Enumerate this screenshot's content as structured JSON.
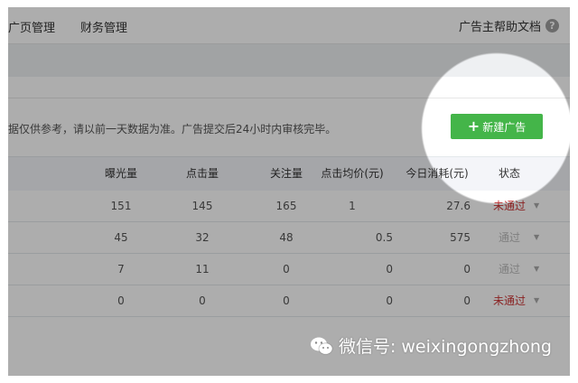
{
  "nav": {
    "items": [
      "广页管理",
      "财务管理"
    ],
    "help_label": "广告主帮助文档",
    "help_icon": "question-circle-icon"
  },
  "notice": "据仅供参考，请以前一天数据为准。广告提交后24小时内审核完毕。",
  "new_ad_button": {
    "label": "新建广告",
    "icon": "plus-icon"
  },
  "table": {
    "headers": [
      "曝光量",
      "点击量",
      "关注量",
      "点击均价(元)",
      "今日消耗(元)",
      "状态"
    ],
    "rows": [
      {
        "impressions": "151",
        "clicks": "145",
        "follows": "165",
        "avg_cpc": "1",
        "spend": "27.6",
        "status": "未通过",
        "status_kind": "fail"
      },
      {
        "impressions": "45",
        "clicks": "32",
        "follows": "48",
        "avg_cpc": "0.5",
        "spend": "575",
        "status": "通过",
        "status_kind": "pass"
      },
      {
        "impressions": "7",
        "clicks": "11",
        "follows": "0",
        "avg_cpc": "0",
        "spend": "0",
        "status": "通过",
        "status_kind": "pass"
      },
      {
        "impressions": "0",
        "clicks": "0",
        "follows": "0",
        "avg_cpc": "0",
        "spend": "0",
        "status": "未通过",
        "status_kind": "fail"
      }
    ]
  },
  "watermark": {
    "text": "微信号: weixingongzhong",
    "icon": "wechat-logo-icon"
  },
  "colors": {
    "accent_green": "#44b549",
    "fail_red": "#cc3333",
    "pass_gray": "#bbbbbb"
  }
}
